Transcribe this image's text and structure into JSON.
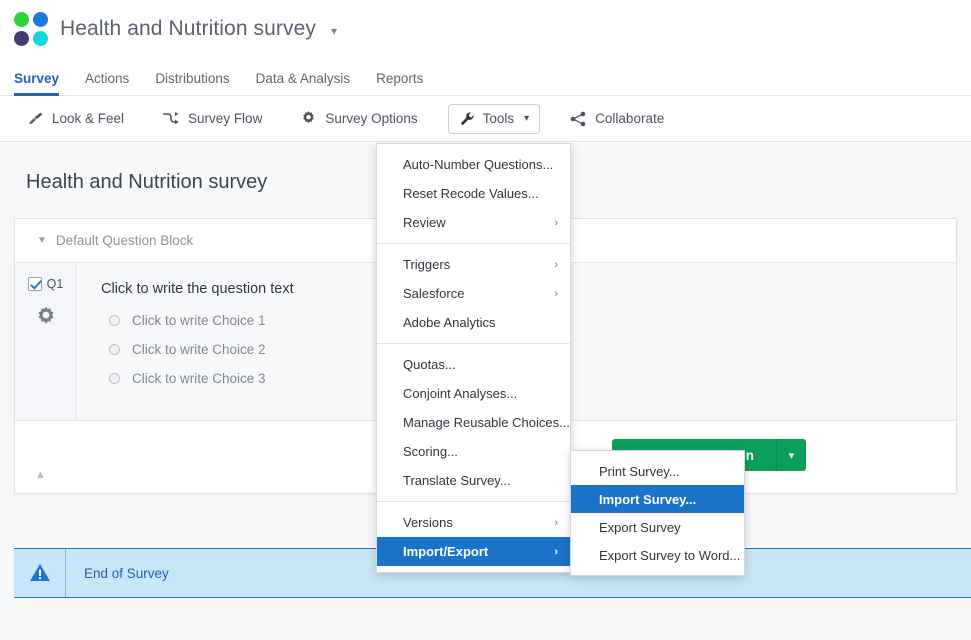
{
  "header": {
    "survey_title": "Health and Nutrition survey",
    "title_caret_icon": "chevron-down-icon",
    "logo_icon": "qualtrics-logo"
  },
  "tabs": [
    {
      "label": "Survey",
      "active": true
    },
    {
      "label": "Actions",
      "active": false
    },
    {
      "label": "Distributions",
      "active": false
    },
    {
      "label": "Data & Analysis",
      "active": false
    },
    {
      "label": "Reports",
      "active": false
    }
  ],
  "toolbar": [
    {
      "label": "Look & Feel",
      "icon": "paintbrush-icon"
    },
    {
      "label": "Survey Flow",
      "icon": "flow-arrow-icon"
    },
    {
      "label": "Survey Options",
      "icon": "gear-icon"
    },
    {
      "label": "Tools",
      "icon": "wrench-icon",
      "open": true,
      "caret": "chevron-down-icon"
    },
    {
      "label": "Collaborate",
      "icon": "share-icon"
    }
  ],
  "page": {
    "title": "Health and Nutrition survey",
    "block_name": "Default Question Block",
    "block_collapse_icon": "triangle-down-icon",
    "collapse_chevron_icon": "chevron-up-icon"
  },
  "question": {
    "number": "Q1",
    "checkbox_icon": "checkbox-checked-icon",
    "gear_icon": "gear-icon",
    "text": "Click to write the question text",
    "choices": [
      "Click to write Choice 1",
      "Click to write Choice 2",
      "Click to write Choice 3"
    ]
  },
  "add_question": {
    "label": "Add New Question",
    "caret_icon": "chevron-down-icon"
  },
  "end_of_survey": {
    "label": "End of Survey",
    "icon": "warning-triangle-icon"
  },
  "tools_menu": {
    "groups": [
      {
        "items": [
          {
            "label": "Auto-Number Questions...",
            "submenu": false
          },
          {
            "label": "Reset Recode Values...",
            "submenu": false
          },
          {
            "label": "Review",
            "submenu": true
          }
        ]
      },
      {
        "items": [
          {
            "label": "Triggers",
            "submenu": true
          },
          {
            "label": "Salesforce",
            "submenu": true
          },
          {
            "label": "Adobe Analytics",
            "submenu": false
          }
        ]
      },
      {
        "items": [
          {
            "label": "Quotas...",
            "submenu": false
          },
          {
            "label": "Conjoint Analyses...",
            "submenu": false
          },
          {
            "label": "Manage Reusable Choices...",
            "submenu": false
          },
          {
            "label": "Scoring...",
            "submenu": false
          },
          {
            "label": "Translate Survey...",
            "submenu": false
          }
        ]
      },
      {
        "items": [
          {
            "label": "Versions",
            "submenu": true
          },
          {
            "label": "Import/Export",
            "submenu": true,
            "selected": true
          }
        ]
      }
    ],
    "submenu_arrow_icon": "chevron-right-icon"
  },
  "import_export_submenu": {
    "items": [
      {
        "label": "Print Survey...",
        "selected": false
      },
      {
        "label": "Import Survey...",
        "selected": true
      },
      {
        "label": "Export Survey",
        "selected": false
      },
      {
        "label": "Export Survey to Word...",
        "selected": false
      }
    ]
  },
  "colors": {
    "accent_blue": "#1f62b8",
    "menu_highlight": "#1a73c8",
    "green_button": "#0aa05a",
    "banner_blue": "#c9e6f8"
  }
}
